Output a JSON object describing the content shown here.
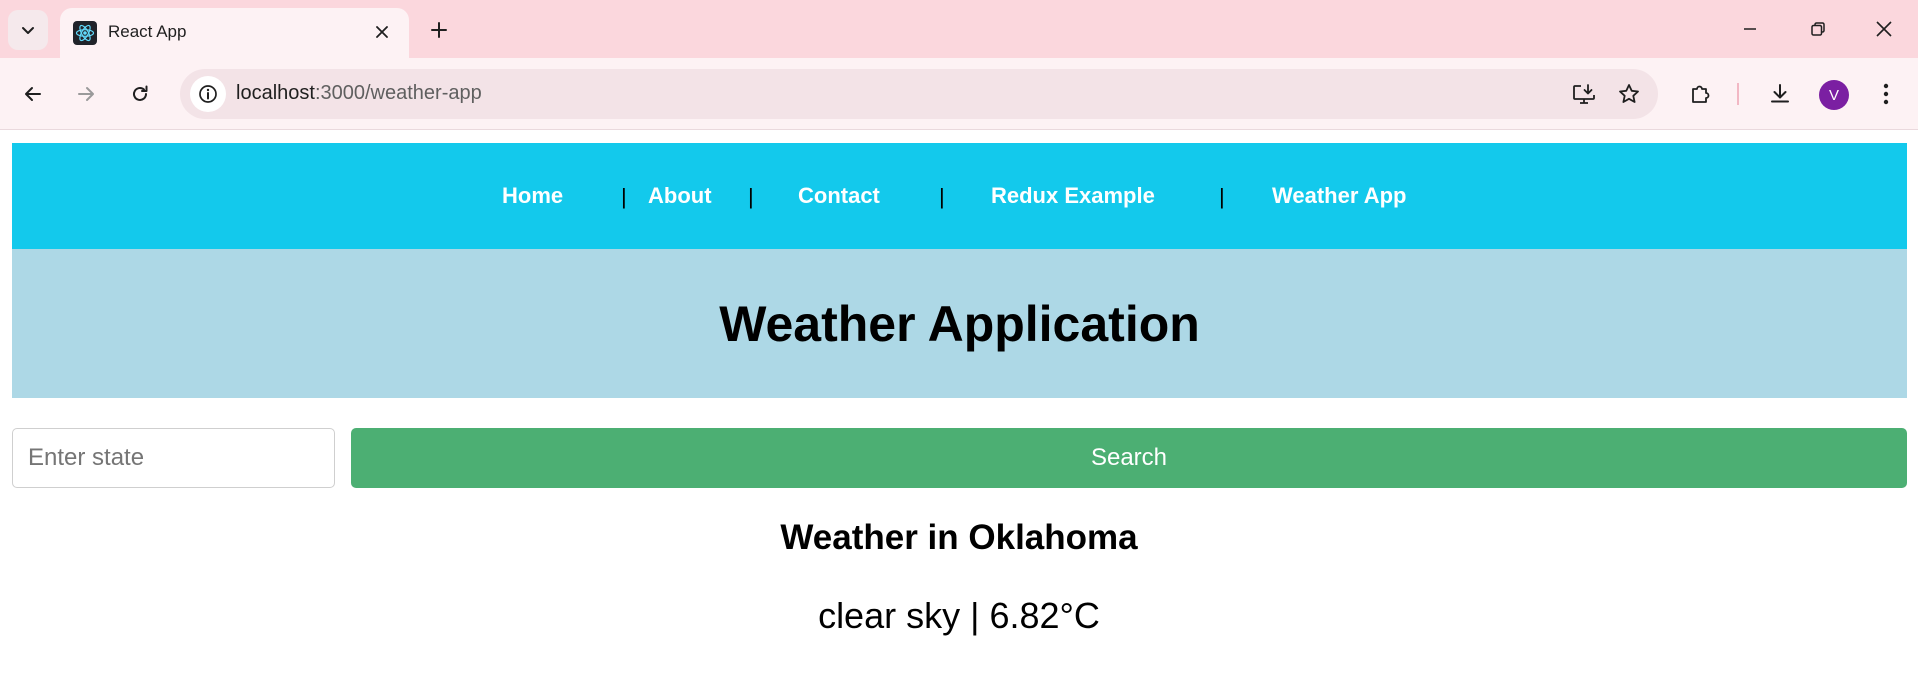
{
  "browser": {
    "tab_title": "React App",
    "url_host": "localhost",
    "url_path": ":3000/weather-app",
    "profile_initial": "V",
    "icons": {
      "tab_search": "chevron-down-icon",
      "favicon": "react-icon",
      "tab_close": "close-icon",
      "new_tab": "plus-icon",
      "minimize": "minimize-icon",
      "restore": "restore-icon",
      "close_window": "close-icon",
      "back": "arrow-left-icon",
      "forward": "arrow-right-icon",
      "reload": "reload-icon",
      "site_info": "info-icon",
      "install": "install-icon",
      "bookmark": "star-icon",
      "extensions": "puzzle-icon",
      "downloads": "download-icon",
      "menu": "kebab-menu-icon"
    }
  },
  "nav": {
    "links": [
      "Home",
      "About",
      "Contact",
      "Redux Example",
      "Weather App"
    ],
    "separator": "|"
  },
  "header": {
    "title": "Weather Application"
  },
  "search": {
    "placeholder": "Enter state",
    "value": "",
    "button_label": "Search"
  },
  "result": {
    "title": "Weather in Oklahoma",
    "description": "clear sky | 6.82°C"
  },
  "colors": {
    "tabstrip": "#fbd7dd",
    "toolbar": "#fdf2f4",
    "navbar": "#13c9ec",
    "header": "#add8e6",
    "search_button": "#4caf73",
    "avatar": "#7b1fa2"
  }
}
